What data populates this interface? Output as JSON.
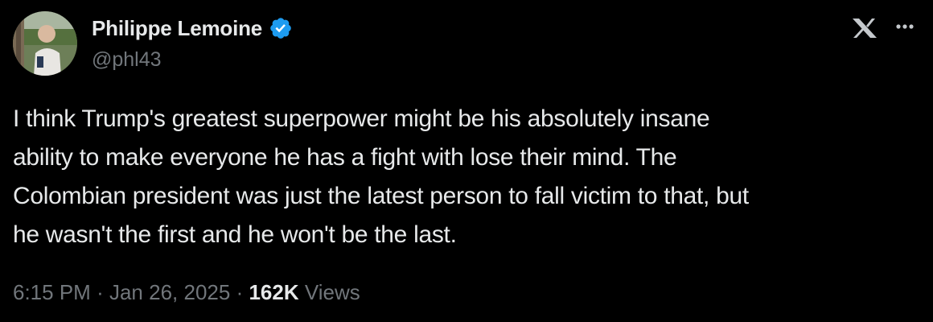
{
  "author": {
    "display_name": "Philippe Lemoine",
    "handle": "@phl43",
    "verified": true,
    "verified_color": "#1d9bf0"
  },
  "tweet": {
    "text_lines": [
      "I think Trump's greatest superpower might be his absolutely insane",
      "ability to make everyone he has a fight with lose their mind. The",
      "Colombian president was just the latest person to fall victim to that, but",
      "he wasn't the first and he won't be the last."
    ],
    "time": "6:15 PM",
    "separator": "·",
    "date": "Jan 26, 2025",
    "views_count": "162K",
    "views_label": "Views"
  },
  "icons": {
    "logo": "x-logo-icon",
    "more": "more-options-icon",
    "verified": "verified-badge-icon"
  },
  "theme": {
    "background": "#000000",
    "text_primary": "#e7e9ea",
    "text_secondary": "#71767b"
  }
}
